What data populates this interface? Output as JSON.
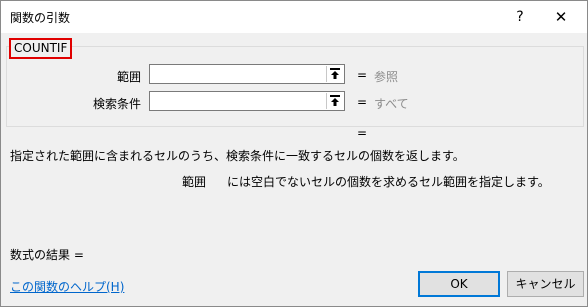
{
  "window": {
    "title": "関数の引数",
    "help_label": "?",
    "close_label": "✕"
  },
  "function_name": "COUNTIF",
  "args": [
    {
      "label": "範囲",
      "value": "",
      "result": "参照"
    },
    {
      "label": "検索条件",
      "value": "",
      "result": "すべて"
    }
  ],
  "equals": "=",
  "description": "指定された範囲に含まれるセルのうち、検索条件に一致するセルの個数を返します。",
  "arg_description": {
    "name": "範囲",
    "text": "には空白でないセルの個数を求めるセル範囲を指定します。"
  },
  "formula_result_label": "数式の結果 =",
  "help_link": "この関数のヘルプ(H)",
  "buttons": {
    "ok": "OK",
    "cancel": "キャンセル"
  },
  "icons": {
    "ref": "collapse-dialog-icon"
  }
}
